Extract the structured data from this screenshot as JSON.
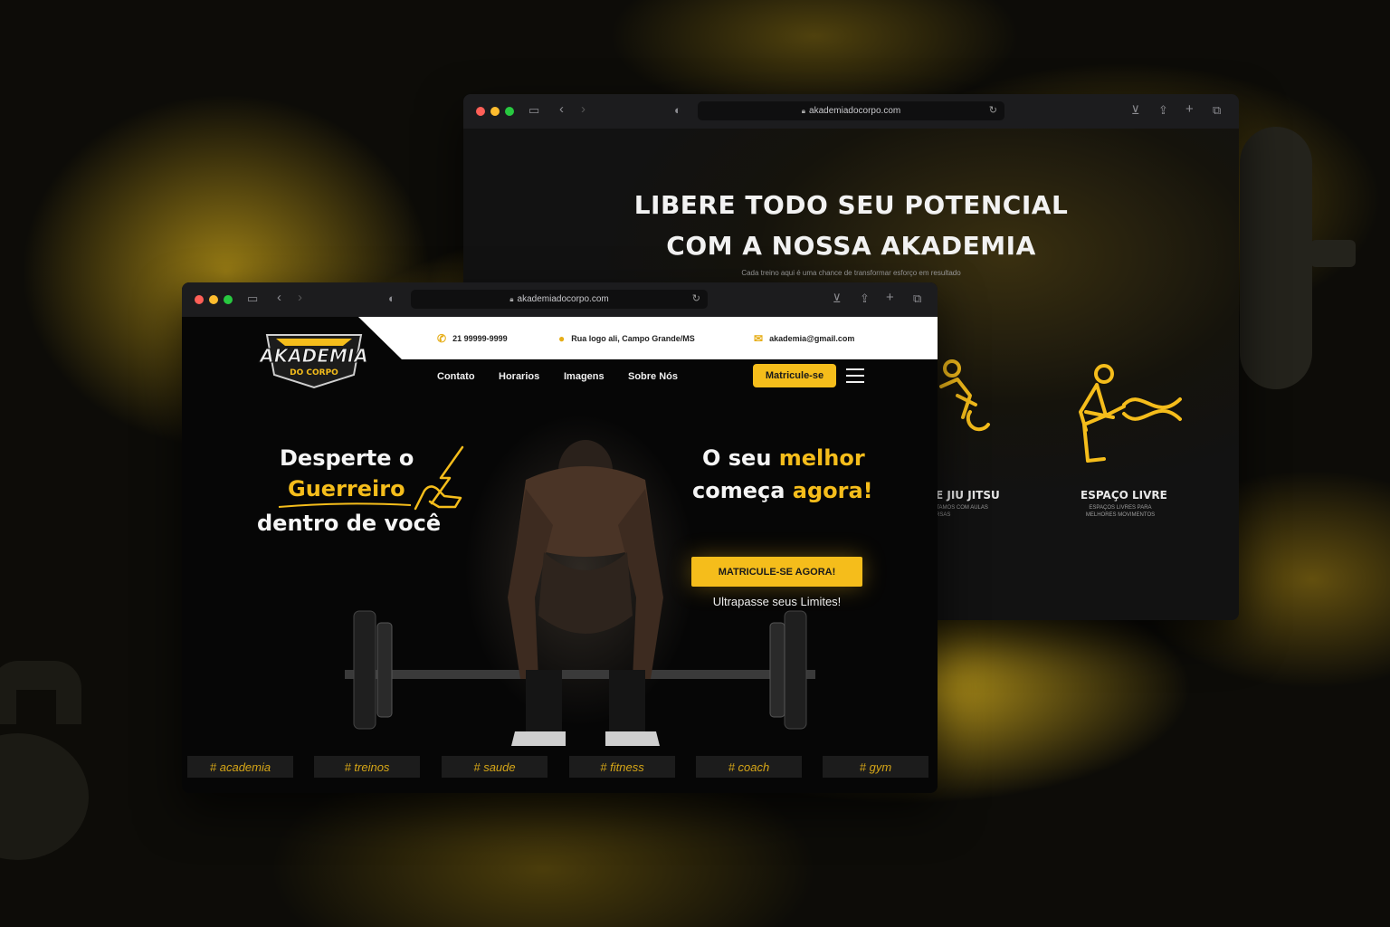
{
  "back_window": {
    "url": "akademiadocorpo.com",
    "headline_line1": "LIBERE TODO SEU POTENCIAL",
    "headline_line2": "COM A NOSSA AKADEMIA",
    "subtitle": "Cada treino aqui é uma chance de transformar esforço em resultado",
    "features": [
      {
        "title": "E JIU JITSU",
        "desc_line1": "NTAMOS COM AULAS",
        "desc_line2": "ERSAS"
      },
      {
        "title": "ESPAÇO LIVRE",
        "desc_line1": "ESPAÇOS LIVRES PARA",
        "desc_line2": "MELHORES MOVIMENTOS"
      }
    ]
  },
  "front_window": {
    "url": "akademiadocorpo.com",
    "logo": {
      "line1": "AKADEMIA",
      "line2": "DO CORPO"
    },
    "contact": {
      "phone": "21 99999-9999",
      "address": "Rua logo ali, Campo Grande/MS",
      "email": "akademia@gmail.com"
    },
    "nav": [
      "Contato",
      "Horarios",
      "Imagens",
      "Sobre Nós"
    ],
    "nav_cta": "Matricule-se",
    "hero_left": {
      "line1": "Desperte o",
      "highlight": "Guerreiro",
      "line3": "dentro de você"
    },
    "hero_right": {
      "part1": "O seu",
      "highlight1": "melhor",
      "part2": "começa",
      "highlight2": "agora!"
    },
    "cta": "MATRICULE-SE AGORA!",
    "tagline": "Ultrapasse seus Limites!",
    "tags": [
      "# academia",
      "# treinos",
      "# saude",
      "# fitness",
      "# coach",
      "# gym"
    ]
  },
  "colors": {
    "accent": "#f5bd1b",
    "background": "#060606"
  },
  "icons": [
    "phone-icon",
    "location-pin-icon",
    "mail-icon",
    "hamburger-menu-icon",
    "lock-icon",
    "reload-icon",
    "download-icon",
    "share-icon",
    "plus-icon",
    "tabs-icon",
    "sidebar-icon",
    "shield-icon",
    "chevron-down-icon"
  ]
}
